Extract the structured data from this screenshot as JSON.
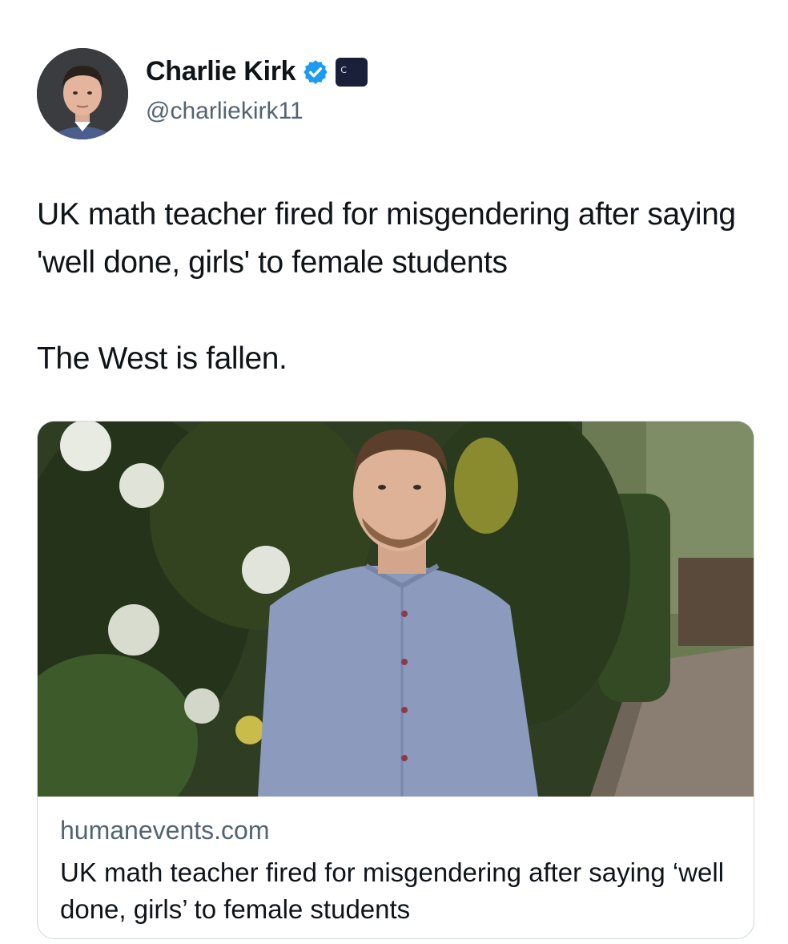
{
  "tweet": {
    "author": {
      "display_name": "Charlie Kirk",
      "handle": "@charliekirk11",
      "verified": true
    },
    "text_line1": "UK math teacher fired for misgendering after saying 'well done, girls' to female students",
    "text_line2": "The West is fallen."
  },
  "link_card": {
    "domain": "humanevents.com",
    "title": "UK math teacher fired for misgendering after saying ‘well done, girls’ to female students"
  },
  "colors": {
    "verified_blue": "#1d9bf0",
    "secondary_text": "#536471",
    "primary_text": "#0f1419",
    "card_border": "#cfd9de"
  },
  "icons": {
    "verified": "verified-badge-icon",
    "affiliate": "affiliate-badge-icon"
  }
}
